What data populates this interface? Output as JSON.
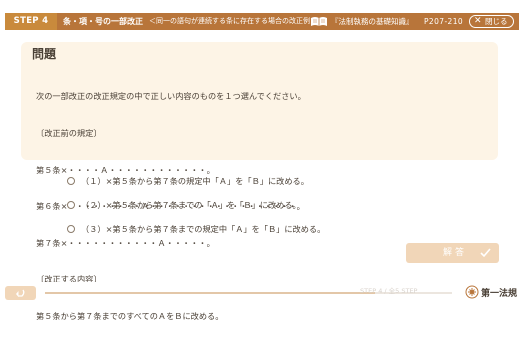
{
  "header": {
    "step": "STEP 4",
    "title": "条・項・号の一部改正",
    "subtitle": "＜同一の語句が連続する条に存在する場合の改正例＞",
    "book_title": "『法制執務の基礎知識』",
    "book_pages": "P207-210",
    "close_label": "閉じる",
    "close_icon": "close-x-icon"
  },
  "question": {
    "heading": "問題",
    "lines": [
      "次の一部改正の改正規定の中で正しい内容のものを１つ選んでください。",
      "〔改正前の規定〕",
      "第５条×・・・・Ａ・・・・・・・・・・・・。",
      "第６条×・・・・・・・・・Ａ・・・・・・・・・・・・・・・・・・。",
      "第７条×・・・・・・・・・・・Ａ・・・・・。",
      "〔改正する内容〕",
      "第５条から第７条までのすべてのＡをＢに改める。"
    ]
  },
  "options": [
    {
      "label": "（１）×第５条から第７条の規定中「Ａ」を「Ｂ」に改める。",
      "selected": false
    },
    {
      "label": "（２）×第５条から第７条までの「Ａ」を「Ｂ」に改める。",
      "selected": false
    },
    {
      "label": "（３）×第５条から第７条までの規定中「Ａ」を「Ｂ」に改める。",
      "selected": false
    }
  ],
  "answer_button": {
    "label": "解答",
    "icon": "check-icon",
    "enabled": false
  },
  "footer": {
    "back_icon": "back-arrow-icon",
    "progress": 0.81,
    "progress_text": "STEP 4 / 全5 STEP",
    "logo_text": "第一法規"
  },
  "colors": {
    "accent": "#b8753a",
    "badge": "#c98a3c",
    "panel": "#fdf4e6",
    "button_disabled": "#f1d6b8",
    "text": "#4a4036"
  }
}
